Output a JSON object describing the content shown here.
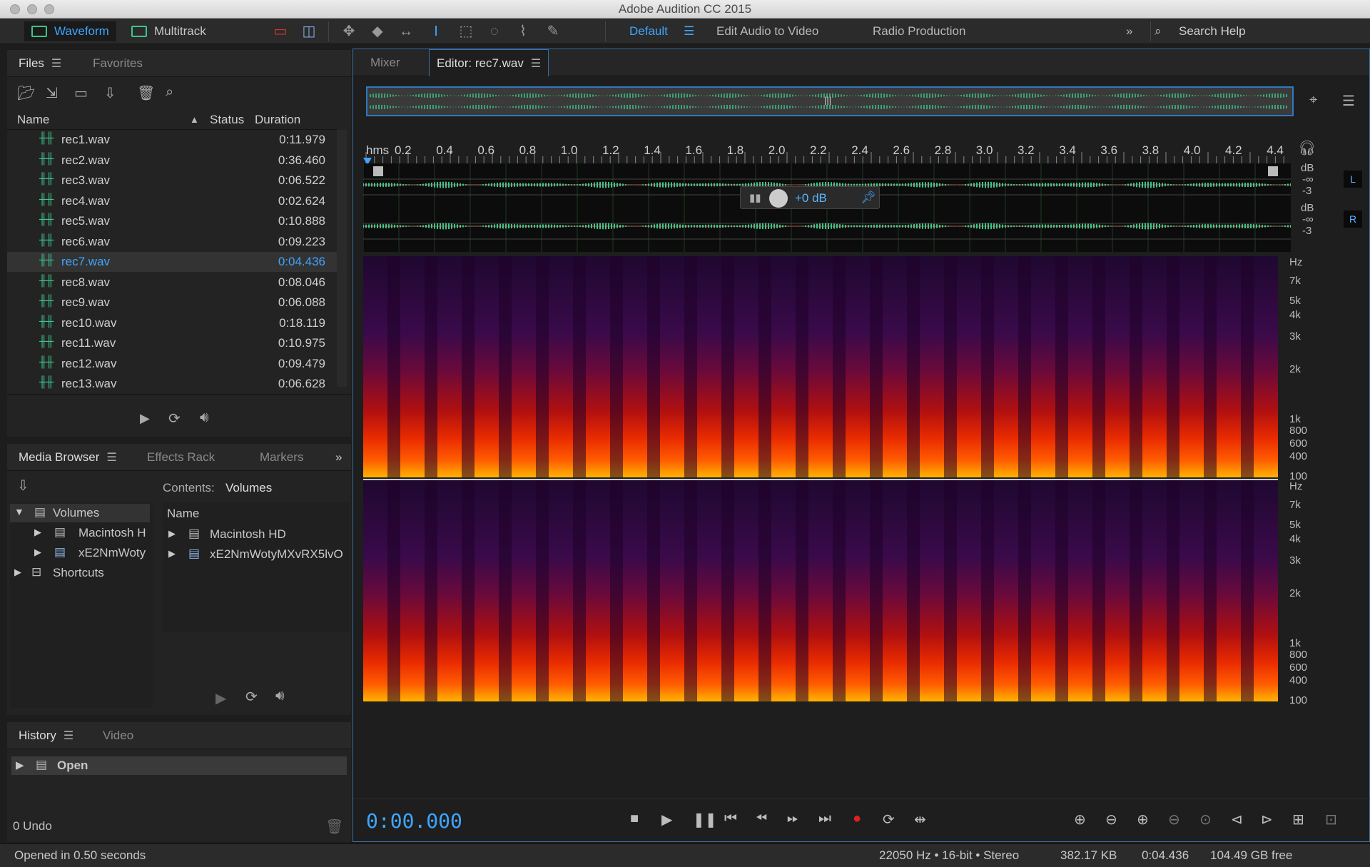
{
  "window": {
    "title": "Adobe Audition CC 2015"
  },
  "toolbar": {
    "modes": [
      "Waveform",
      "Multitrack"
    ],
    "workspaces": [
      "Default",
      "Edit Audio to Video",
      "Radio Production"
    ],
    "search_help": "Search Help"
  },
  "files_panel": {
    "tabs": [
      "Files",
      "Favorites"
    ],
    "columns": {
      "name": "Name",
      "status": "Status",
      "duration": "Duration"
    },
    "rows": [
      {
        "name": "rec1.wav",
        "duration": "0:11.979"
      },
      {
        "name": "rec2.wav",
        "duration": "0:36.460"
      },
      {
        "name": "rec3.wav",
        "duration": "0:06.522"
      },
      {
        "name": "rec4.wav",
        "duration": "0:02.624"
      },
      {
        "name": "rec5.wav",
        "duration": "0:10.888"
      },
      {
        "name": "rec6.wav",
        "duration": "0:09.223"
      },
      {
        "name": "rec7.wav",
        "duration": "0:04.436",
        "selected": true
      },
      {
        "name": "rec8.wav",
        "duration": "0:08.046"
      },
      {
        "name": "rec9.wav",
        "duration": "0:06.088"
      },
      {
        "name": "rec10.wav",
        "duration": "0:18.119"
      },
      {
        "name": "rec11.wav",
        "duration": "0:10.975"
      },
      {
        "name": "rec12.wav",
        "duration": "0:09.479"
      },
      {
        "name": "rec13.wav",
        "duration": "0:06.628"
      }
    ]
  },
  "media_browser": {
    "tabs": [
      "Media Browser",
      "Effects Rack",
      "Markers"
    ],
    "contents_label": "Contents:",
    "contents_value": "Volumes",
    "tree": {
      "volumes": "Volumes",
      "mac": "Macintosh H",
      "drive": "xE2NmWoty",
      "shortcuts": "Shortcuts"
    },
    "name_header": "Name",
    "list": [
      "Macintosh HD",
      "xE2NmWotyMXvRX5lvO"
    ]
  },
  "history": {
    "tabs": [
      "History",
      "Video"
    ],
    "items": [
      "Open"
    ],
    "undo": "0 Undo"
  },
  "editor": {
    "tabs": [
      "Mixer",
      "Editor: rec7.wav"
    ],
    "ruler_unit": "hms",
    "ruler": [
      "0.2",
      "0.4",
      "0.6",
      "0.8",
      "1.0",
      "1.2",
      "1.4",
      "1.6",
      "1.8",
      "2.0",
      "2.2",
      "2.4",
      "2.6",
      "2.8",
      "3.0",
      "3.2",
      "3.4",
      "3.6",
      "3.8",
      "4.0",
      "4.2",
      "4.4"
    ],
    "gain": "+0 dB",
    "db_labels": [
      "dB",
      "-∞",
      "-3"
    ],
    "channels": [
      "L",
      "R"
    ],
    "hz_labels": [
      "Hz",
      "7k",
      "5k",
      "4k",
      "3k",
      "2k",
      "1k",
      "800",
      "600",
      "400",
      "100"
    ],
    "timecode": "0:00.000"
  },
  "status": {
    "message": "Opened in 0.50 seconds",
    "format": "22050 Hz • 16-bit • Stereo",
    "size": "382.17 KB",
    "duration": "0:04.436",
    "free": "104.49 GB free"
  },
  "colors": {
    "accent": "#3ea6ff",
    "waveform": "#3ec48c"
  }
}
